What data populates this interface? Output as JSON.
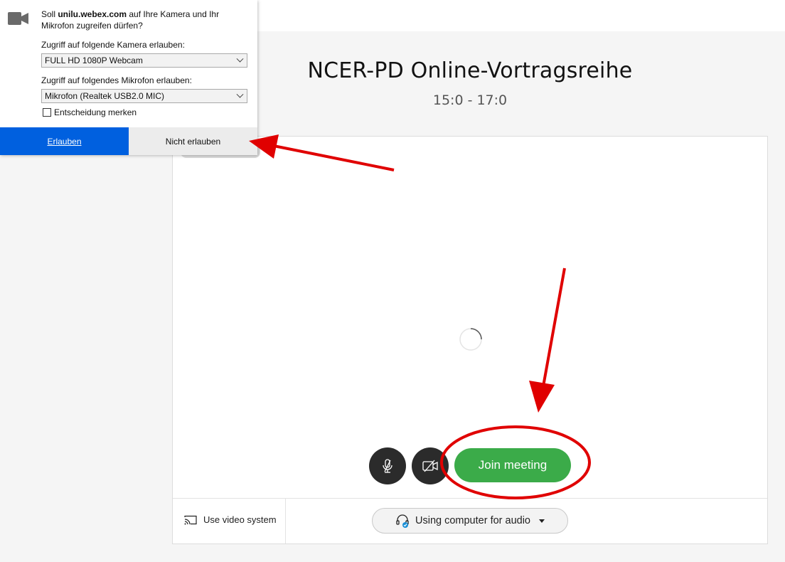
{
  "meeting": {
    "title": "NCER-PD Online-Vortragsreihe",
    "time": "15:0 - 17:0"
  },
  "controls": {
    "mute_icon": "microphone-muted-icon",
    "video_icon": "camera-off-icon",
    "join_label": "Join meeting"
  },
  "footer": {
    "video_system_label": "Use video system",
    "video_system_icon": "cast-icon",
    "audio_label": "Using computer for audio",
    "audio_icon": "headset-icon"
  },
  "permission_dialog": {
    "question_prefix": "Soll ",
    "question_domain": "unilu.webex.com",
    "question_suffix": " auf Ihre Kamera und Ihr Mikrofon zugreifen dürfen?",
    "camera_label": "Zugriff auf folgende Kamera erlauben:",
    "camera_value": "FULL HD 1080P Webcam",
    "mic_label": "Zugriff auf folgendes Mikrofon erlauben:",
    "mic_value": "Mikrofon (Realtek USB2.0 MIC)",
    "remember_label": "Entscheidung merken",
    "allow_label": "Erlauben",
    "deny_label": "Nicht erlauben",
    "icon": "video-camera-icon"
  },
  "colors": {
    "join_green": "#3bab49",
    "allow_blue": "#0060df",
    "annotation_red": "#e00000"
  }
}
